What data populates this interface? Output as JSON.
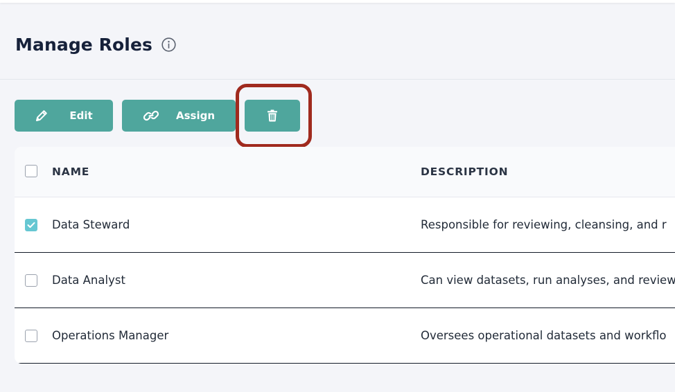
{
  "header": {
    "title": "Manage Roles",
    "info_icon": "info-icon"
  },
  "toolbar": {
    "edit_label": "Edit",
    "edit_icon": "pencil-icon",
    "assign_label": "Assign",
    "assign_icon": "link-icon",
    "delete_icon": "trash-icon",
    "button_color": "#4fa69d",
    "highlight_color": "#a02a1e"
  },
  "table": {
    "columns": [
      "NAME",
      "DESCRIPTION"
    ],
    "rows": [
      {
        "checked": true,
        "name": "Data Steward",
        "description": "Responsible for reviewing, cleansing, and r"
      },
      {
        "checked": false,
        "name": "Data Analyst",
        "description": "Can view datasets, run analyses, and review"
      },
      {
        "checked": false,
        "name": "Operations Manager",
        "description": "Oversees operational datasets and workflo"
      }
    ]
  }
}
